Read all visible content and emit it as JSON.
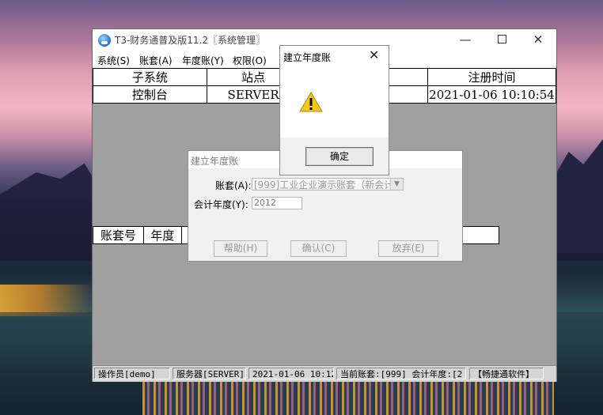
{
  "window": {
    "title": "T3-财务通普及版11.2〖系统管理〗",
    "minimize": "—",
    "close": "✕"
  },
  "menu": [
    "系统(S)",
    "账套(A)",
    "年度账(Y)",
    "权限(O)"
  ],
  "top_table": {
    "headers": [
      "子系统",
      "站点",
      "",
      "注册时间"
    ],
    "row": [
      "控制台",
      "SERVER",
      "",
      "2021-01-06 10:10:54"
    ]
  },
  "bottom_table": {
    "headers": [
      "账套号",
      "年度",
      ""
    ]
  },
  "statusbar": [
    "操作员[demo]",
    "服务器[SERVER]",
    "2021-01-06 10:12",
    "当前账套:[999] 会计年度:[2",
    "【畅捷通软件】"
  ],
  "form_dialog": {
    "title": "建立年度账",
    "account_label": "账套(A):",
    "account_value": "[999]工业企业演示账套（新会计",
    "year_label": "会计年度(Y):",
    "year_value": "2012",
    "help": "帮助(H)",
    "confirm": "确认(C)",
    "cancel": "放弃(E)"
  },
  "alert": {
    "title": "建立年度账",
    "icon": "warning-icon",
    "close": "✕",
    "ok": "确定"
  }
}
